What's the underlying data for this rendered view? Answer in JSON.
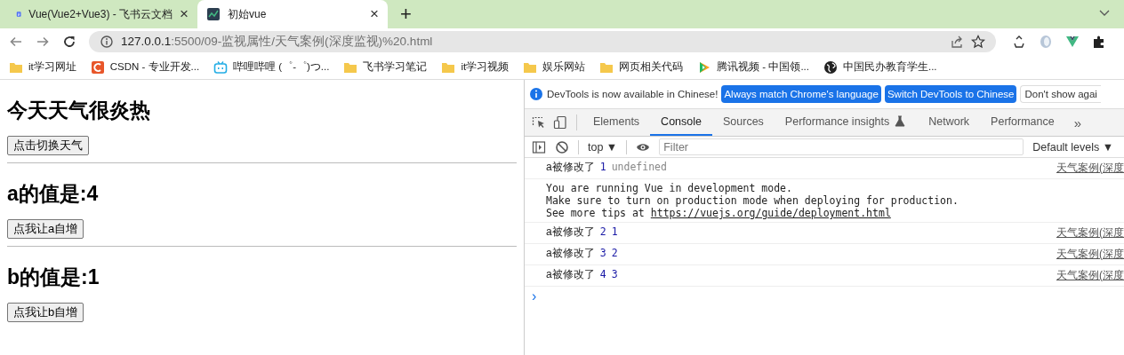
{
  "browser_tabs": [
    {
      "title": "Vue(Vue2+Vue3) - 飞书云文档",
      "selected": false,
      "close": "×"
    },
    {
      "title": "初始vue",
      "selected": true,
      "close": "×"
    }
  ],
  "new_tab": "+",
  "address_bar": {
    "host": "127.0.0.1",
    "path": ":5500/09-监视属性/天气案例(深度监视)%20.html"
  },
  "bookmarks": [
    {
      "label": "it学习网址",
      "kind": "folder"
    },
    {
      "label": "CSDN - 专业开发...",
      "kind": "csdn"
    },
    {
      "label": "哔哩哔哩 (゜-゜)つ...",
      "kind": "tv"
    },
    {
      "label": "飞书学习笔记",
      "kind": "folder"
    },
    {
      "label": "it学习视频",
      "kind": "folder"
    },
    {
      "label": "娱乐网站",
      "kind": "folder"
    },
    {
      "label": "网页相关代码",
      "kind": "folder"
    },
    {
      "label": "腾讯视频 - 中国领...",
      "kind": "play"
    },
    {
      "label": "中国民办教育学生...",
      "kind": "globe"
    }
  ],
  "page": {
    "sections": [
      {
        "heading": "今天天气很炎热",
        "button": "点击切换天气"
      },
      {
        "heading": "a的值是:4",
        "button": "点我让a自增"
      },
      {
        "heading": "b的值是:1",
        "button": "点我让b自增"
      }
    ]
  },
  "devtools": {
    "infobar": {
      "message": "DevTools is now available in Chinese!",
      "buttons": [
        "Always match Chrome's language",
        "Switch DevTools to Chinese"
      ],
      "dismiss": "Don't show agai"
    },
    "tabs": [
      {
        "label": "Elements",
        "selected": false
      },
      {
        "label": "Console",
        "selected": true
      },
      {
        "label": "Sources",
        "selected": false
      },
      {
        "label": "Performance insights",
        "selected": false
      },
      {
        "label": "Network",
        "selected": false
      },
      {
        "label": "Performance",
        "selected": false
      }
    ],
    "more_tabs": "»",
    "context": "top ▼",
    "filter": {
      "placeholder": "Filter"
    },
    "levels": "Default levels ▼",
    "messages": [
      {
        "kind": "log",
        "text": "a被修改了",
        "args": [
          {
            "kind": "number",
            "value": "1"
          },
          {
            "kind": "undefined",
            "value": "undefined"
          }
        ],
        "source": "天气案例(深度"
      },
      {
        "kind": "info",
        "lines": [
          "You are running Vue in development mode.",
          "Make sure to turn on production mode when deploying for production.",
          "See more tips at"
        ],
        "link": "https://vuejs.org/guide/deployment.html"
      },
      {
        "kind": "log",
        "text": "a被修改了",
        "args": [
          {
            "kind": "number",
            "value": "2"
          },
          {
            "kind": "number",
            "value": "1"
          }
        ],
        "source": "天气案例(深度"
      },
      {
        "kind": "log",
        "text": "a被修改了",
        "args": [
          {
            "kind": "number",
            "value": "3"
          },
          {
            "kind": "number",
            "value": "2"
          }
        ],
        "source": "天气案例(深度"
      },
      {
        "kind": "log",
        "text": "a被修改了",
        "args": [
          {
            "kind": "number",
            "value": "4"
          },
          {
            "kind": "number",
            "value": "3"
          }
        ],
        "source": "天气案例(深度"
      }
    ],
    "prompt": "›"
  }
}
